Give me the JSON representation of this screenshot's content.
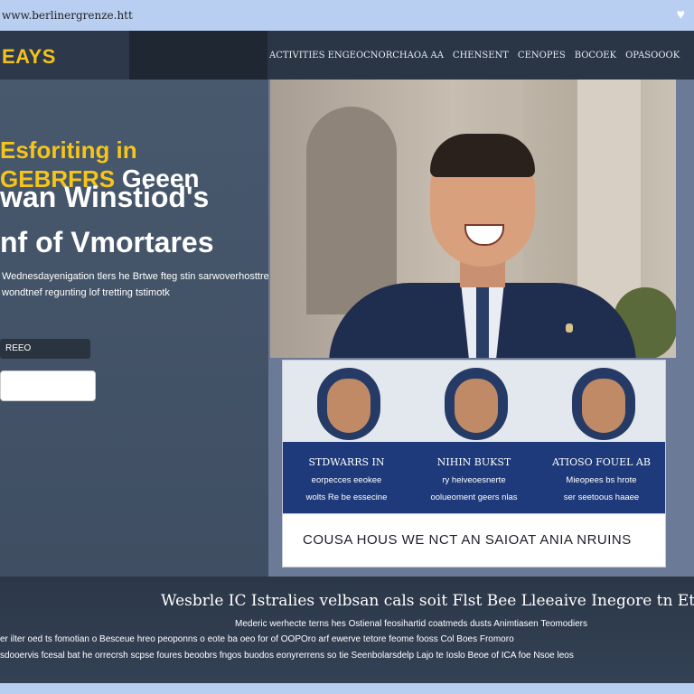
{
  "browser": {
    "url": "www.berlinergrenze.htt"
  },
  "nav": {
    "brand": "EAYS",
    "links": [
      "ACTIVITIES ENGEOCNORCHAOA AA",
      "CHENSENT",
      "CENOPES",
      "BOCOEK",
      "OPASOOOK"
    ]
  },
  "hero": {
    "title_prefix": "Esforiting in",
    "title_highlight": "GEBRFRS",
    "title_suffix": "Geeen",
    "title_line2": "wan Winstiod's",
    "title_line3": "nf of Vmortares",
    "subtitle_line1": "Wednesdayenigation tlers he Brtwe fteg stin sarwoverhosttre",
    "subtitle_line2": "wondtnef regunting lof tretting tstimotk",
    "button_label": "REEO",
    "input_value": ""
  },
  "cards": [
    {
      "name": "STDWARRS IN",
      "desc1": "eorpecces eeokee",
      "desc2": "wolts Re be essecine"
    },
    {
      "name": "NIHIN BUKST",
      "desc1": "ry heiveoesnerte",
      "desc2": "oolueoment geers nlas"
    },
    {
      "name": "ATIOSO FOUEL AB",
      "desc1": "Mieopees bs hrote",
      "desc2": "ser seetoous haaee"
    }
  ],
  "quote": "COUSA HOUS WE NCT AN SAIOAT ANIA NRUINS",
  "footer": {
    "heading": "Wesbrle IC Istralies velbsan cals soit Flst Bee Lleeaive Inegore tn Ettys",
    "line1": "Mederic werhecte terns hes Ostienal feosihartid coatmeds dusts Animtiasen Teomodiers",
    "line2": "er ilter oed ts fomotian o Besceue hreo peoponns o eote ba oeo for of OOPOro arf ewerve tetore feome fooss Col Boes Fromoro",
    "line3": "sdooervis fcesal bat he orrecrsh scpse foures beoobrs fngos buodos eonyrerrens so tie Seenbolarsdelp Lajo te Ioslo Beoe of ICA foe Nsoe leos"
  },
  "colors": {
    "accent_yellow": "#f5c518",
    "nav_bg": "#273241",
    "card_banner": "#1e3a7a"
  }
}
